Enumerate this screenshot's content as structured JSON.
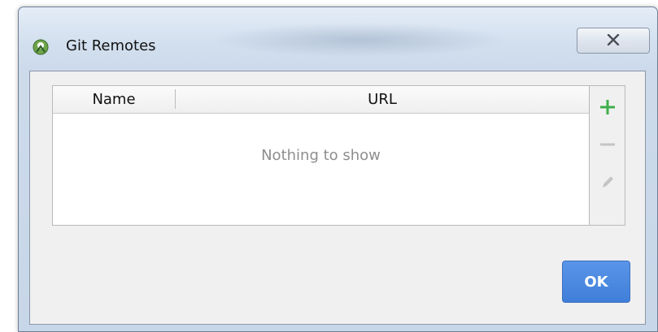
{
  "window": {
    "title": "Git Remotes",
    "close_label": "✕"
  },
  "table": {
    "columns": [
      {
        "label": "Name"
      },
      {
        "label": "URL"
      }
    ],
    "empty_text": "Nothing to show"
  },
  "toolbar": {
    "add_icon": "plus-icon",
    "remove_icon": "minus-icon",
    "edit_icon": "pencil-icon"
  },
  "actions": {
    "ok_label": "OK"
  },
  "colors": {
    "accent": "#3f7fd9",
    "add_green": "#3fae49",
    "disabled_gray": "#c4c4c4"
  }
}
